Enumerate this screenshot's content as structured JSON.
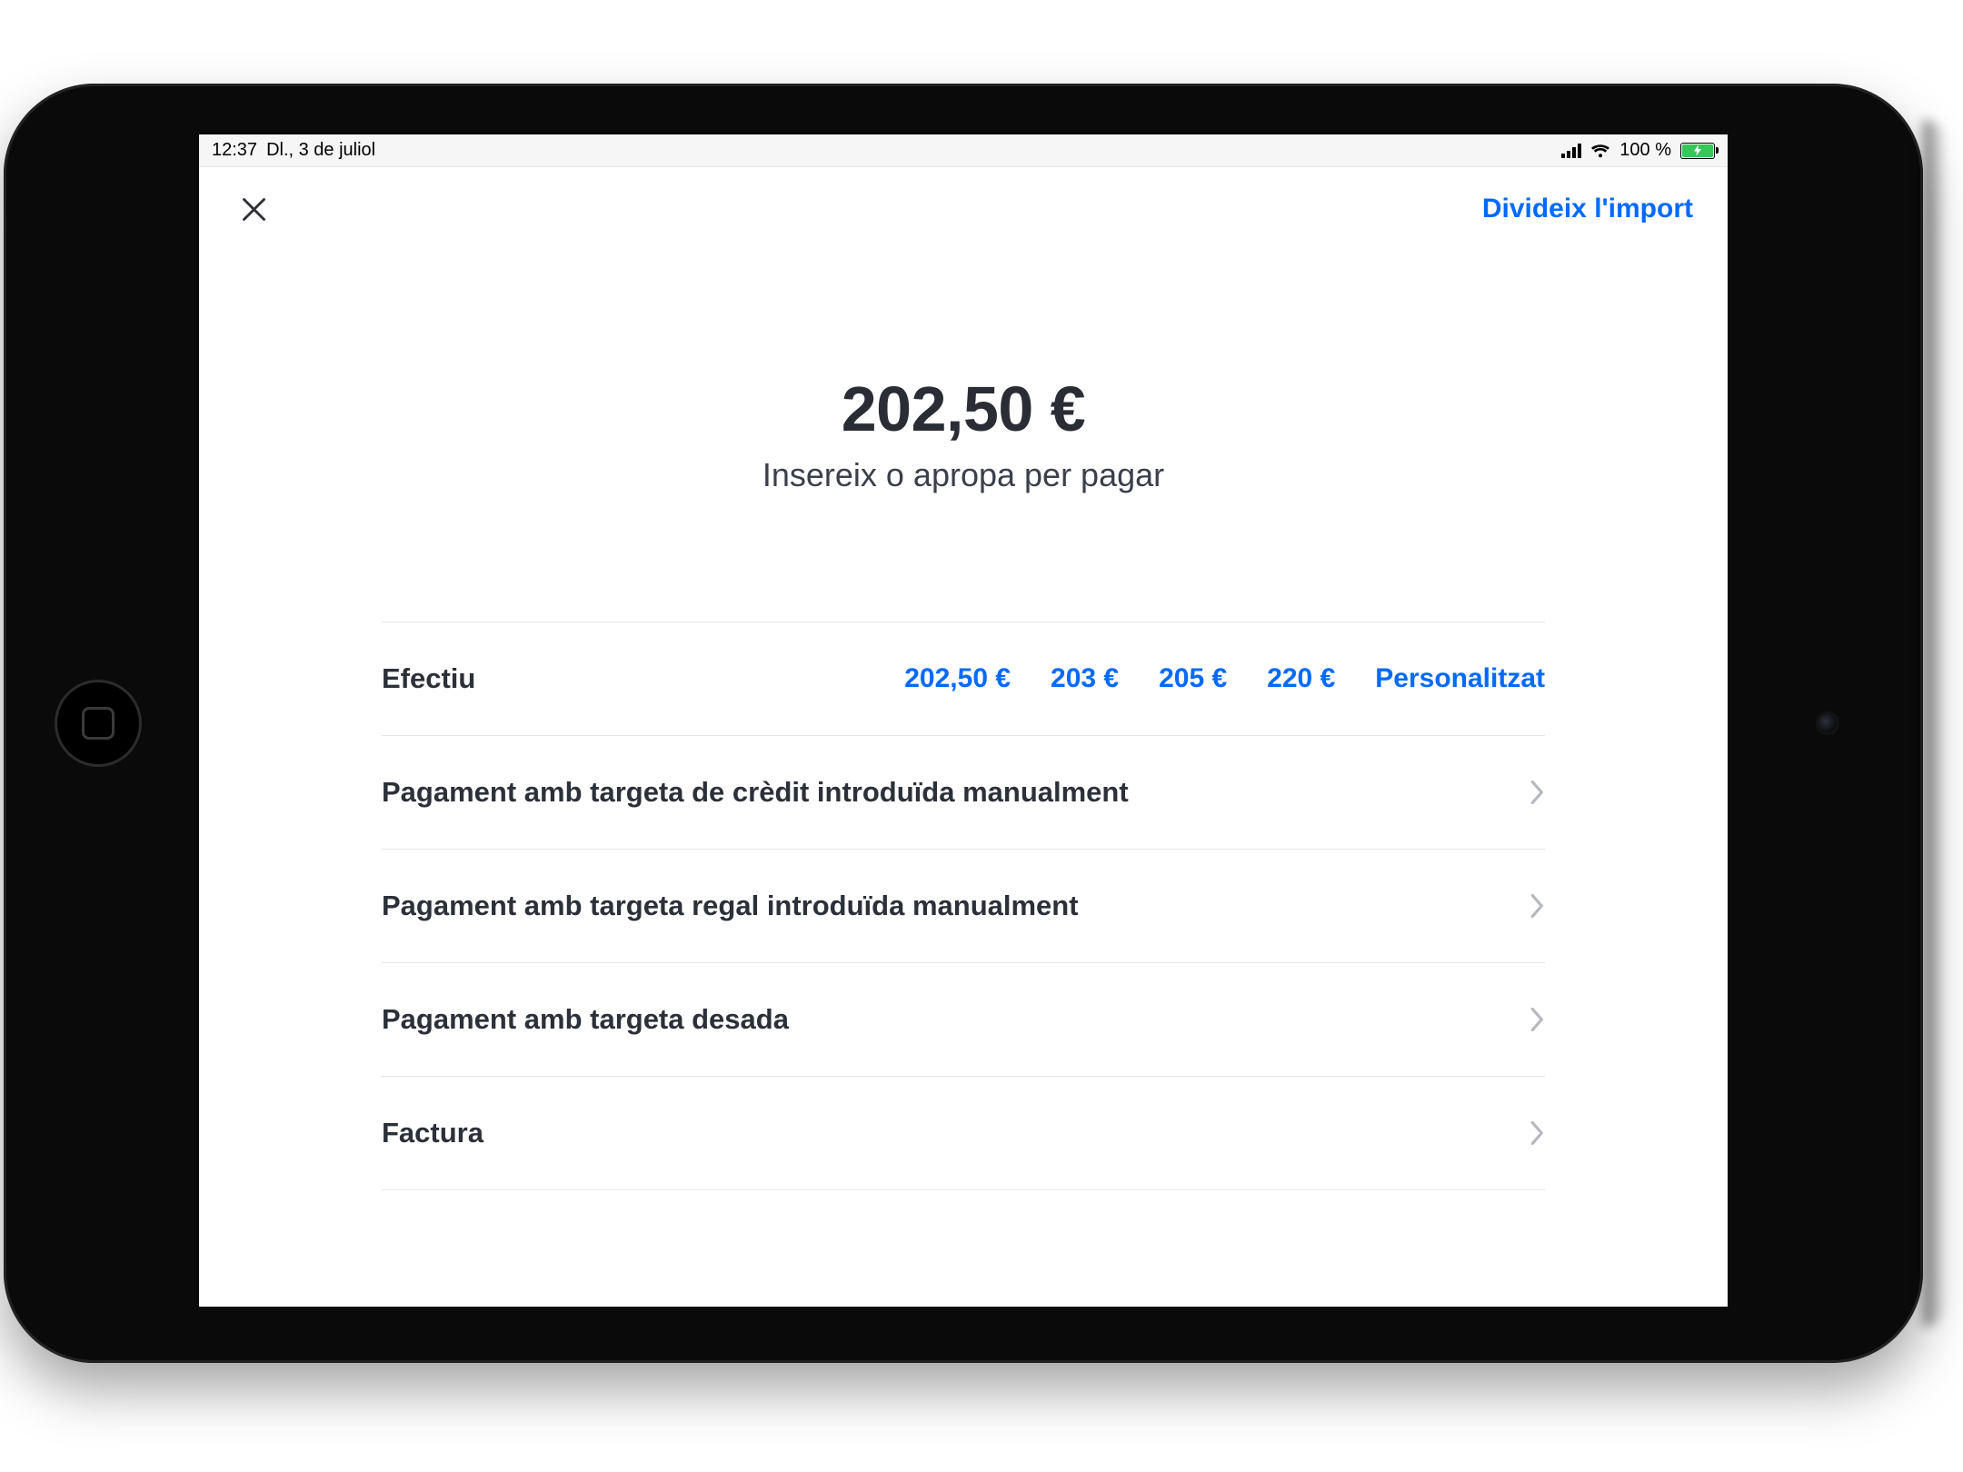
{
  "status": {
    "time": "12:37",
    "date": "Dl., 3 de juliol",
    "battery_pct": "100 %"
  },
  "nav": {
    "split_label": "Divideix l'import"
  },
  "amount": {
    "value": "202,50 €",
    "subtitle": "Insereix o apropa per pagar"
  },
  "cash": {
    "label": "Efectiu",
    "quick": {
      "exact": "202,50 €",
      "q1": "203 €",
      "q2": "205 €",
      "q3": "220 €",
      "custom": "Personalitzat"
    }
  },
  "rows": {
    "manual_credit": "Pagament amb targeta de crèdit introduïda manualment",
    "manual_gift": "Pagament amb targeta regal introduïda manualment",
    "saved_card": "Pagament amb targeta desada",
    "invoice": "Factura"
  }
}
